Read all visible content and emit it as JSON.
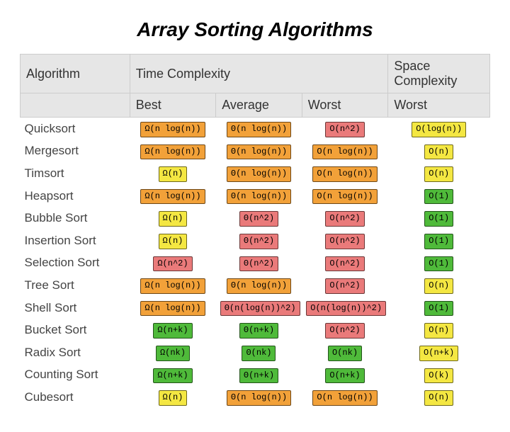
{
  "title": "Array Sorting Algorithms",
  "headers": {
    "algorithm": "Algorithm",
    "time": "Time Complexity",
    "space": "Space Complexity",
    "best": "Best",
    "average": "Average",
    "worst": "Worst",
    "space_worst": "Worst"
  },
  "colors": {
    "green": "#4fba3a",
    "yellow": "#f4e742",
    "orange": "#f2a139",
    "red": "#ea7a7a"
  },
  "chart_data": {
    "type": "table",
    "title": "Array Sorting Algorithms",
    "columns": [
      "Algorithm",
      "Time Best",
      "Time Average",
      "Time Worst",
      "Space Worst"
    ],
    "rows": [
      {
        "name": "Quicksort",
        "best": {
          "v": "Ω(n log(n))",
          "c": "orange"
        },
        "avg": {
          "v": "Θ(n log(n))",
          "c": "orange"
        },
        "worst": {
          "v": "O(n^2)",
          "c": "red"
        },
        "space": {
          "v": "O(log(n))",
          "c": "yellow"
        }
      },
      {
        "name": "Mergesort",
        "best": {
          "v": "Ω(n log(n))",
          "c": "orange"
        },
        "avg": {
          "v": "Θ(n log(n))",
          "c": "orange"
        },
        "worst": {
          "v": "O(n log(n))",
          "c": "orange"
        },
        "space": {
          "v": "O(n)",
          "c": "yellow"
        }
      },
      {
        "name": "Timsort",
        "best": {
          "v": "Ω(n)",
          "c": "yellow"
        },
        "avg": {
          "v": "Θ(n log(n))",
          "c": "orange"
        },
        "worst": {
          "v": "O(n log(n))",
          "c": "orange"
        },
        "space": {
          "v": "O(n)",
          "c": "yellow"
        }
      },
      {
        "name": "Heapsort",
        "best": {
          "v": "Ω(n log(n))",
          "c": "orange"
        },
        "avg": {
          "v": "Θ(n log(n))",
          "c": "orange"
        },
        "worst": {
          "v": "O(n log(n))",
          "c": "orange"
        },
        "space": {
          "v": "O(1)",
          "c": "green"
        }
      },
      {
        "name": "Bubble Sort",
        "best": {
          "v": "Ω(n)",
          "c": "yellow"
        },
        "avg": {
          "v": "Θ(n^2)",
          "c": "red"
        },
        "worst": {
          "v": "O(n^2)",
          "c": "red"
        },
        "space": {
          "v": "O(1)",
          "c": "green"
        }
      },
      {
        "name": "Insertion Sort",
        "best": {
          "v": "Ω(n)",
          "c": "yellow"
        },
        "avg": {
          "v": "Θ(n^2)",
          "c": "red"
        },
        "worst": {
          "v": "O(n^2)",
          "c": "red"
        },
        "space": {
          "v": "O(1)",
          "c": "green"
        }
      },
      {
        "name": "Selection Sort",
        "best": {
          "v": "Ω(n^2)",
          "c": "red"
        },
        "avg": {
          "v": "Θ(n^2)",
          "c": "red"
        },
        "worst": {
          "v": "O(n^2)",
          "c": "red"
        },
        "space": {
          "v": "O(1)",
          "c": "green"
        }
      },
      {
        "name": "Tree Sort",
        "best": {
          "v": "Ω(n log(n))",
          "c": "orange"
        },
        "avg": {
          "v": "Θ(n log(n))",
          "c": "orange"
        },
        "worst": {
          "v": "O(n^2)",
          "c": "red"
        },
        "space": {
          "v": "O(n)",
          "c": "yellow"
        }
      },
      {
        "name": "Shell Sort",
        "best": {
          "v": "Ω(n log(n))",
          "c": "orange"
        },
        "avg": {
          "v": "Θ(n(log(n))^2)",
          "c": "red"
        },
        "worst": {
          "v": "O(n(log(n))^2)",
          "c": "red"
        },
        "space": {
          "v": "O(1)",
          "c": "green"
        }
      },
      {
        "name": "Bucket Sort",
        "best": {
          "v": "Ω(n+k)",
          "c": "green"
        },
        "avg": {
          "v": "Θ(n+k)",
          "c": "green"
        },
        "worst": {
          "v": "O(n^2)",
          "c": "red"
        },
        "space": {
          "v": "O(n)",
          "c": "yellow"
        }
      },
      {
        "name": "Radix Sort",
        "best": {
          "v": "Ω(nk)",
          "c": "green"
        },
        "avg": {
          "v": "Θ(nk)",
          "c": "green"
        },
        "worst": {
          "v": "O(nk)",
          "c": "green"
        },
        "space": {
          "v": "O(n+k)",
          "c": "yellow"
        }
      },
      {
        "name": "Counting Sort",
        "best": {
          "v": "Ω(n+k)",
          "c": "green"
        },
        "avg": {
          "v": "Θ(n+k)",
          "c": "green"
        },
        "worst": {
          "v": "O(n+k)",
          "c": "green"
        },
        "space": {
          "v": "O(k)",
          "c": "yellow"
        }
      },
      {
        "name": "Cubesort",
        "best": {
          "v": "Ω(n)",
          "c": "yellow"
        },
        "avg": {
          "v": "Θ(n log(n))",
          "c": "orange"
        },
        "worst": {
          "v": "O(n log(n))",
          "c": "orange"
        },
        "space": {
          "v": "O(n)",
          "c": "yellow"
        }
      }
    ]
  }
}
